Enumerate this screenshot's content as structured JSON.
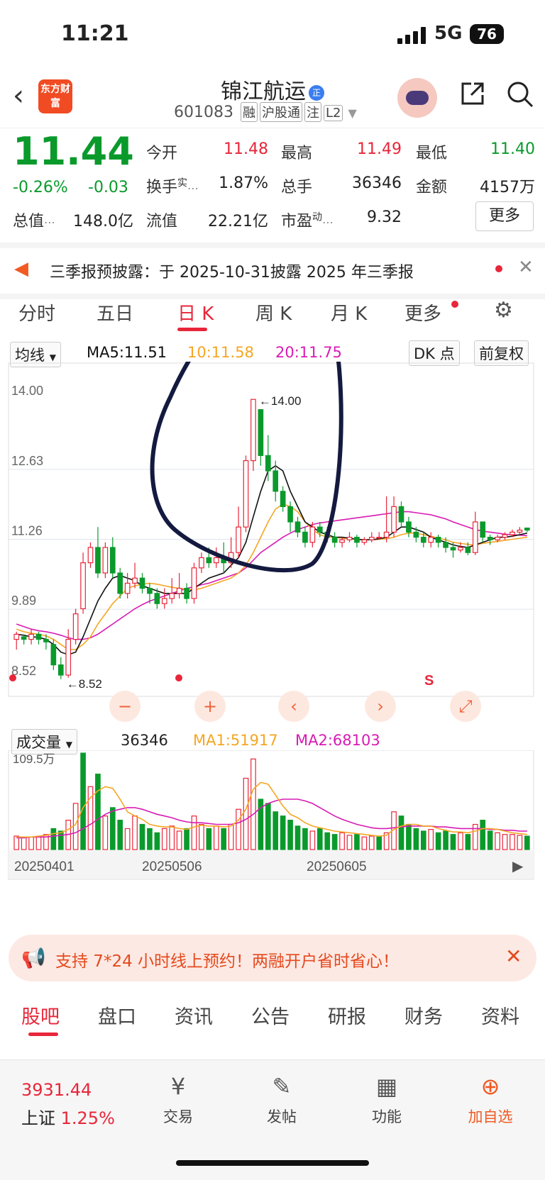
{
  "status_bar": {
    "time": "11:21",
    "network": "5G",
    "battery": "76"
  },
  "header": {
    "logo_text": "东方财富",
    "title": "锦江航运",
    "title_badge": "正",
    "code": "601083",
    "tags": [
      "融",
      "沪股通",
      "注",
      "L2"
    ]
  },
  "quote": {
    "price": "11.44",
    "pct": "-0.26%",
    "chg": "-0.03",
    "open_label": "今开",
    "open": "11.48",
    "high_label": "最高",
    "high": "11.49",
    "low_label": "最低",
    "low": "11.40",
    "turnover_label": "换手",
    "turnover_sup": "实",
    "turnover": "1.87%",
    "volume_label": "总手",
    "volume": "36346",
    "amount_label": "金额",
    "amount": "4157万",
    "mktcap_label": "总值",
    "mktcap": "148.0亿",
    "float_label": "流值",
    "float": "22.21亿",
    "pe_label": "市盈",
    "pe_sup": "动",
    "pe": "9.32",
    "more": "更多"
  },
  "notice": {
    "text": "三季报预披露：于 2025-10-31披露 2025 年三季报"
  },
  "k_tabs": [
    "分时",
    "五日",
    "日 K",
    "周 K",
    "月 K",
    "更多"
  ],
  "ma_bar": {
    "select": "均线",
    "ma5": "MA5:11.51",
    "ma10": "10:11.58",
    "ma20": "20:11.75",
    "dk": "DK 点",
    "adjust": "前复权"
  },
  "volume_bar": {
    "select": "成交量",
    "value": "36346",
    "ma1": "MA1:51917",
    "ma2": "MA2:68103"
  },
  "banner": {
    "text": "支持 7*24 小时线上预约！两融开户省时省心！"
  },
  "bottom_tabs": [
    "股吧",
    "盘口",
    "资讯",
    "公告",
    "研报",
    "财务",
    "资料"
  ],
  "footer": {
    "index_value": "3931.44",
    "index_name": "上证",
    "index_pct": "1.25%",
    "items": [
      "交易",
      "发帖",
      "功能",
      "加自选"
    ]
  },
  "colors": {
    "up": "#e8263a",
    "down": "#0a9a2c",
    "ma5": "#111111",
    "ma10": "#f5a623",
    "ma20": "#d81bb4"
  },
  "chart_data": [
    {
      "type": "candlestick",
      "y_ticks": [
        "14.00",
        "12.63",
        "11.26",
        "9.89",
        "8.52"
      ],
      "ylim": [
        8.52,
        14.0
      ],
      "annotations": {
        "max_label": "14.00",
        "min_label": "8.52"
      },
      "candles": [
        [
          9.3,
          9.4,
          9.1,
          9.45
        ],
        [
          9.35,
          9.3,
          9.2,
          9.4
        ],
        [
          9.3,
          9.4,
          9.2,
          9.5
        ],
        [
          9.4,
          9.3,
          9.2,
          9.45
        ],
        [
          9.3,
          9.25,
          9.1,
          9.4
        ],
        [
          9.2,
          8.8,
          8.7,
          9.3
        ],
        [
          8.8,
          8.6,
          8.52,
          8.95
        ],
        [
          8.6,
          9.3,
          8.55,
          9.5
        ],
        [
          9.3,
          9.8,
          9.2,
          9.9
        ],
        [
          9.9,
          10.8,
          9.8,
          11.0
        ],
        [
          10.8,
          11.1,
          10.7,
          11.2
        ],
        [
          11.1,
          10.6,
          10.5,
          11.5
        ],
        [
          10.6,
          11.1,
          10.5,
          11.2
        ],
        [
          11.1,
          10.6,
          10.5,
          11.3
        ],
        [
          10.6,
          10.2,
          10.1,
          10.7
        ],
        [
          10.2,
          10.4,
          10.1,
          10.6
        ],
        [
          10.4,
          10.5,
          10.3,
          10.8
        ],
        [
          10.5,
          10.3,
          10.2,
          10.6
        ],
        [
          10.3,
          10.2,
          10.0,
          10.4
        ],
        [
          10.2,
          10.0,
          9.9,
          10.3
        ],
        [
          10.0,
          10.1,
          9.9,
          10.3
        ],
        [
          10.1,
          10.2,
          10.0,
          10.5
        ],
        [
          10.2,
          10.3,
          10.1,
          10.6
        ],
        [
          10.3,
          10.1,
          10.0,
          10.4
        ],
        [
          10.1,
          10.7,
          10.0,
          10.8
        ],
        [
          10.7,
          10.9,
          10.6,
          11.0
        ],
        [
          10.9,
          10.8,
          10.7,
          11.1
        ],
        [
          10.8,
          10.9,
          10.7,
          11.1
        ],
        [
          10.9,
          10.8,
          10.6,
          11.2
        ],
        [
          10.8,
          11.0,
          10.7,
          11.3
        ],
        [
          11.0,
          11.5,
          10.9,
          11.9
        ],
        [
          11.5,
          12.8,
          11.4,
          12.9
        ],
        [
          12.8,
          14.0,
          12.6,
          14.0
        ],
        [
          13.8,
          12.9,
          12.7,
          13.8
        ],
        [
          12.9,
          12.6,
          12.4,
          13.3
        ],
        [
          12.6,
          12.2,
          12.0,
          12.8
        ],
        [
          12.2,
          11.9,
          11.8,
          12.3
        ],
        [
          11.9,
          11.6,
          11.4,
          12.0
        ],
        [
          11.6,
          11.4,
          11.3,
          11.7
        ],
        [
          11.4,
          11.2,
          11.1,
          11.5
        ],
        [
          11.2,
          11.5,
          11.1,
          11.6
        ],
        [
          11.5,
          11.4,
          11.3,
          11.6
        ],
        [
          11.4,
          11.3,
          11.2,
          11.5
        ],
        [
          11.3,
          11.2,
          11.1,
          11.4
        ],
        [
          11.2,
          11.25,
          11.1,
          11.3
        ],
        [
          11.25,
          11.3,
          11.2,
          11.4
        ],
        [
          11.3,
          11.2,
          11.1,
          11.35
        ],
        [
          11.2,
          11.25,
          11.15,
          11.3
        ],
        [
          11.25,
          11.3,
          11.2,
          11.4
        ],
        [
          11.3,
          11.3,
          11.25,
          11.4
        ],
        [
          11.3,
          11.4,
          11.2,
          12.1
        ],
        [
          11.4,
          11.9,
          11.3,
          12.1
        ],
        [
          11.9,
          11.6,
          11.5,
          12.0
        ],
        [
          11.6,
          11.4,
          11.3,
          11.7
        ],
        [
          11.4,
          11.3,
          11.2,
          11.5
        ],
        [
          11.3,
          11.2,
          11.1,
          11.4
        ],
        [
          11.2,
          11.3,
          11.1,
          11.4
        ],
        [
          11.3,
          11.2,
          11.1,
          11.35
        ],
        [
          11.2,
          11.1,
          11.0,
          11.3
        ],
        [
          11.1,
          11.05,
          10.9,
          11.2
        ],
        [
          11.05,
          11.1,
          11.0,
          11.2
        ],
        [
          11.1,
          11.0,
          10.95,
          11.2
        ],
        [
          11.0,
          11.6,
          10.95,
          11.8
        ],
        [
          11.6,
          11.3,
          11.2,
          11.6
        ],
        [
          11.3,
          11.25,
          11.15,
          11.35
        ],
        [
          11.25,
          11.3,
          11.2,
          11.35
        ],
        [
          11.3,
          11.35,
          11.25,
          11.4
        ],
        [
          11.35,
          11.4,
          11.3,
          11.45
        ],
        [
          11.4,
          11.44,
          11.35,
          11.5
        ],
        [
          11.48,
          11.44,
          11.4,
          11.49
        ]
      ],
      "ma5": [
        9.4,
        9.38,
        9.35,
        9.34,
        9.3,
        9.2,
        9.05,
        9.0,
        9.05,
        9.35,
        9.7,
        10.05,
        10.3,
        10.5,
        10.55,
        10.5,
        10.45,
        10.35,
        10.3,
        10.25,
        10.2,
        10.2,
        10.2,
        10.2,
        10.3,
        10.4,
        10.5,
        10.55,
        10.6,
        10.75,
        10.9,
        11.2,
        11.7,
        12.2,
        12.6,
        12.7,
        12.6,
        12.2,
        11.9,
        11.6,
        11.5,
        11.4,
        11.35,
        11.3,
        11.3,
        11.28,
        11.26,
        11.25,
        11.25,
        11.27,
        11.3,
        11.4,
        11.5,
        11.5,
        11.45,
        11.4,
        11.3,
        11.25,
        11.2,
        11.15,
        11.12,
        11.1,
        11.15,
        11.2,
        11.25,
        11.3,
        11.3,
        11.32,
        11.35,
        11.38
      ],
      "ma10": [
        9.5,
        9.45,
        9.42,
        9.4,
        9.37,
        9.3,
        9.2,
        9.1,
        9.1,
        9.2,
        9.35,
        9.6,
        9.8,
        10.0,
        10.15,
        10.3,
        10.35,
        10.38,
        10.4,
        10.38,
        10.35,
        10.32,
        10.3,
        10.28,
        10.27,
        10.3,
        10.35,
        10.4,
        10.45,
        10.5,
        10.6,
        10.75,
        11.0,
        11.3,
        11.6,
        11.85,
        11.95,
        11.9,
        11.8,
        11.6,
        11.45,
        11.35,
        11.3,
        11.3,
        11.28,
        11.27,
        11.26,
        11.25,
        11.25,
        11.26,
        11.27,
        11.3,
        11.35,
        11.38,
        11.38,
        11.35,
        11.32,
        11.28,
        11.25,
        11.2,
        11.18,
        11.16,
        11.15,
        11.18,
        11.2,
        11.22,
        11.24,
        11.26,
        11.28,
        11.3
      ],
      "ma20": [
        9.6,
        9.55,
        9.5,
        9.47,
        9.45,
        9.42,
        9.38,
        9.33,
        9.3,
        9.3,
        9.33,
        9.4,
        9.5,
        9.6,
        9.7,
        9.8,
        9.9,
        9.98,
        10.05,
        10.1,
        10.15,
        10.2,
        10.25,
        10.3,
        10.33,
        10.37,
        10.4,
        10.45,
        10.5,
        10.55,
        10.6,
        10.7,
        10.85,
        11.0,
        11.1,
        11.2,
        11.3,
        11.38,
        11.45,
        11.5,
        11.55,
        11.58,
        11.6,
        11.62,
        11.64,
        11.66,
        11.68,
        11.7,
        11.72,
        11.74,
        11.76,
        11.78,
        11.8,
        11.8,
        11.78,
        11.76,
        11.74,
        11.7,
        11.66,
        11.6,
        11.55,
        11.5,
        11.45,
        11.42,
        11.4,
        11.38,
        11.36,
        11.35,
        11.34,
        11.33
      ]
    },
    {
      "type": "bar",
      "title": "成交量",
      "ymax_label": "109.5万",
      "ylim": [
        0,
        1095000
      ],
      "x_labels": [
        "20250401",
        "20250506",
        "20250605"
      ],
      "volume": [
        16,
        14,
        15,
        16,
        18,
        25,
        22,
        35,
        55,
        115,
        75,
        90,
        40,
        50,
        35,
        25,
        40,
        30,
        25,
        20,
        25,
        28,
        22,
        25,
        40,
        30,
        25,
        28,
        25,
        30,
        48,
        85,
        108,
        60,
        55,
        45,
        40,
        35,
        28,
        25,
        22,
        25,
        20,
        18,
        20,
        17,
        18,
        15,
        16,
        15,
        20,
        45,
        40,
        30,
        25,
        22,
        24,
        20,
        22,
        18,
        20,
        18,
        30,
        35,
        22,
        20,
        18,
        18,
        17,
        16
      ],
      "up": [
        1,
        1,
        1,
        1,
        1,
        0,
        0,
        1,
        1,
        0,
        1,
        0,
        1,
        0,
        0,
        1,
        1,
        0,
        0,
        0,
        1,
        1,
        1,
        0,
        1,
        1,
        0,
        1,
        0,
        1,
        1,
        1,
        1,
        0,
        0,
        0,
        0,
        0,
        0,
        0,
        1,
        0,
        0,
        0,
        1,
        1,
        0,
        1,
        1,
        0,
        1,
        1,
        0,
        0,
        0,
        0,
        1,
        0,
        0,
        0,
        1,
        0,
        1,
        0,
        0,
        1,
        1,
        1,
        1,
        0
      ],
      "ma1": [
        15,
        15,
        15,
        16,
        17,
        19,
        20,
        24,
        30,
        50,
        62,
        70,
        75,
        73,
        60,
        45,
        40,
        36,
        30,
        28,
        27,
        27,
        25,
        24,
        27,
        29,
        28,
        28,
        27,
        28,
        35,
        48,
        72,
        80,
        78,
        65,
        52,
        42,
        38,
        32,
        28,
        26,
        24,
        22,
        21,
        20,
        19,
        18,
        17,
        16,
        17,
        24,
        28,
        30,
        30,
        28,
        28,
        25,
        23,
        21,
        21,
        20,
        22,
        25,
        25,
        24,
        22,
        20,
        19,
        18
      ],
      "ma2": [
        14,
        14,
        15,
        15,
        15,
        16,
        17,
        18,
        20,
        25,
        30,
        36,
        42,
        46,
        48,
        50,
        50,
        48,
        45,
        42,
        40,
        38,
        35,
        33,
        32,
        32,
        31,
        30,
        30,
        30,
        32,
        36,
        42,
        50,
        55,
        58,
        60,
        60,
        60,
        58,
        55,
        50,
        45,
        40,
        36,
        33,
        30,
        28,
        26,
        25,
        25,
        26,
        27,
        28,
        28,
        28,
        28,
        27,
        27,
        26,
        25,
        25,
        25,
        25,
        24,
        24,
        23,
        23,
        22,
        22
      ]
    }
  ]
}
